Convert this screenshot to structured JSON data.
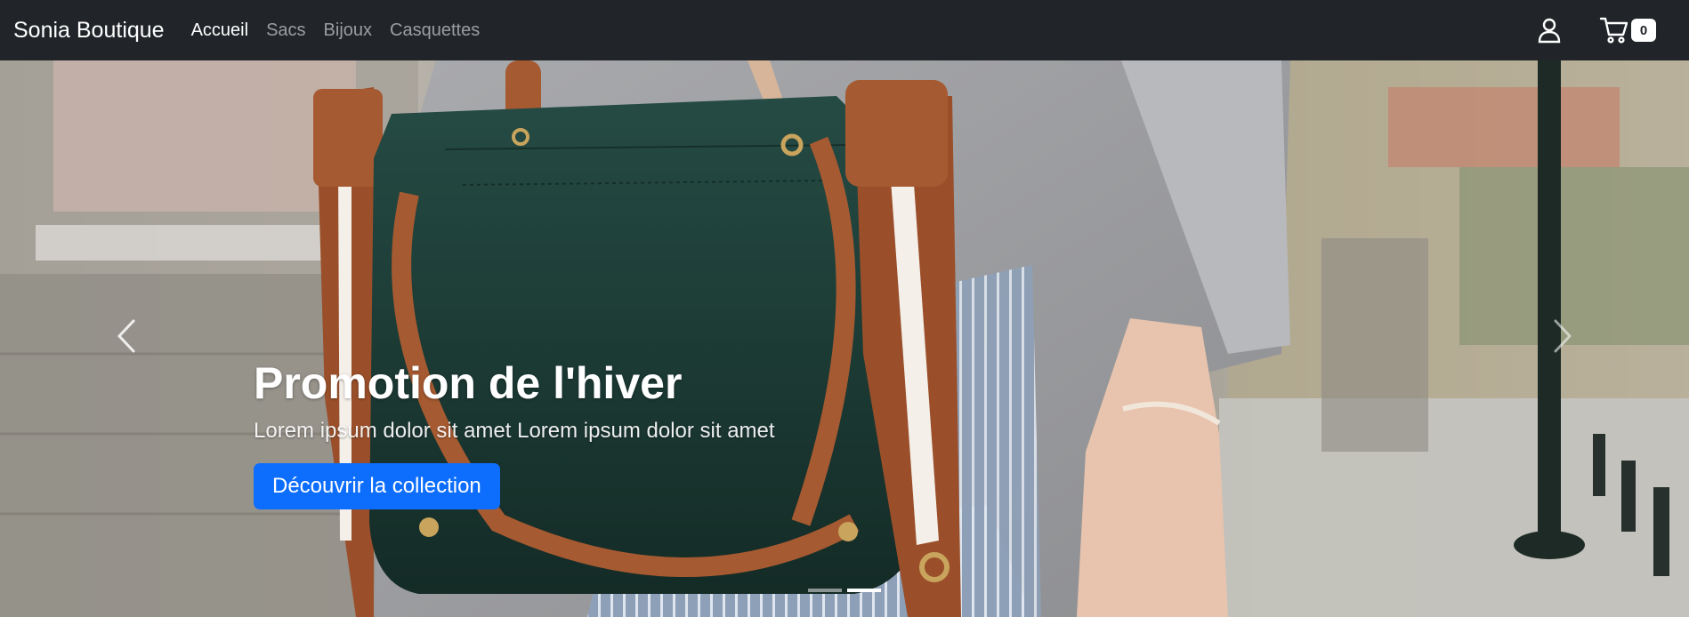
{
  "navbar": {
    "brand": "Sonia Boutique",
    "links": [
      {
        "label": "Accueil",
        "active": true
      },
      {
        "label": "Sacs",
        "active": false
      },
      {
        "label": "Bijoux",
        "active": false
      },
      {
        "label": "Casquettes",
        "active": false
      }
    ],
    "user_icon": "user-icon",
    "cart_icon": "cart-icon",
    "cart_count": "0"
  },
  "hero": {
    "title": "Promotion de l'hiver",
    "text": "Lorem ipsum dolor sit amet Lorem ipsum dolor sit amet",
    "button_label": "Découvrir la collection",
    "prev_icon": "chevron-left-icon",
    "next_icon": "chevron-right-icon",
    "slide_count": 2,
    "active_slide": 2
  },
  "colors": {
    "navbar_bg": "#212529",
    "accent": "#0d6efd",
    "bag": "#1f3d36",
    "strap": "#9a4f2a"
  }
}
